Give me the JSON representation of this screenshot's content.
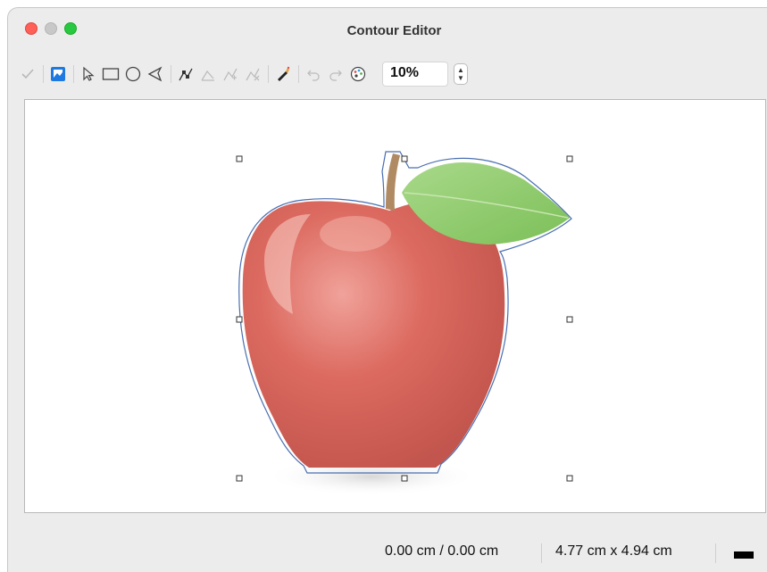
{
  "window": {
    "title": "Contour Editor"
  },
  "toolbar": {
    "tools": [
      {
        "name": "apply-icon",
        "enabled": false
      },
      {
        "name": "workspace-icon",
        "enabled": true,
        "active": true
      },
      {
        "name": "select-icon",
        "enabled": true
      },
      {
        "name": "rectangle-icon",
        "enabled": true
      },
      {
        "name": "ellipse-icon",
        "enabled": true
      },
      {
        "name": "polygon-icon",
        "enabled": true
      },
      {
        "name": "edit-points-icon",
        "enabled": true
      },
      {
        "name": "move-points-icon",
        "enabled": false
      },
      {
        "name": "insert-points-icon",
        "enabled": false
      },
      {
        "name": "delete-points-icon",
        "enabled": false
      },
      {
        "name": "autocontour-icon",
        "enabled": true
      },
      {
        "name": "undo-icon",
        "enabled": false
      },
      {
        "name": "redo-icon",
        "enabled": false
      },
      {
        "name": "pipette-icon",
        "enabled": true
      }
    ],
    "zoom": "10%"
  },
  "status": {
    "position": "0.00 cm / 0.00 cm",
    "size": "4.77 cm x 4.94 cm"
  },
  "colors": {
    "apple_red": "#d85a52",
    "leaf_green": "#8fcf6a",
    "contour_line": "#4a6fb0"
  }
}
